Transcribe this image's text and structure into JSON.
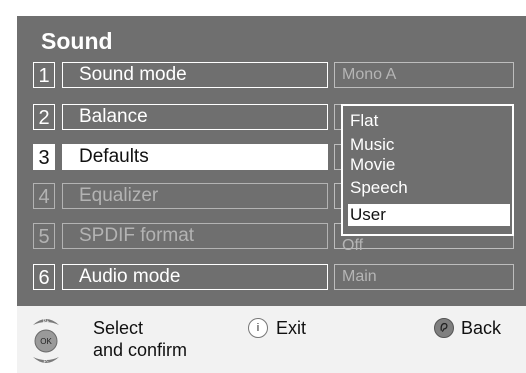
{
  "menu": {
    "title": "Sound",
    "rows": [
      {
        "num": "1",
        "label": "Sound mode",
        "value": "Mono A"
      },
      {
        "num": "2",
        "label": "Balance",
        "value": ""
      },
      {
        "num": "3",
        "label": "Defaults",
        "value": ""
      },
      {
        "num": "4",
        "label": "Equalizer",
        "value": ""
      },
      {
        "num": "5",
        "label": "SPDIF format",
        "value": "Off"
      },
      {
        "num": "6",
        "label": "Audio mode",
        "value": "Main"
      }
    ]
  },
  "dropdown": {
    "options": [
      "Flat",
      "Music",
      "Movie",
      "Speech",
      "User"
    ],
    "selected": "User"
  },
  "footer": {
    "select_label_line1": "Select",
    "select_label_line2": "and confirm",
    "exit_label": "Exit",
    "back_label": "Back",
    "ok_key": "OK",
    "prog_up_key": "P+",
    "prog_down_key": "P-",
    "info_key": "i"
  },
  "colors": {
    "panel": "#6f6f6f",
    "highlight": "#ffffff",
    "footer": "#f2f2f2"
  }
}
